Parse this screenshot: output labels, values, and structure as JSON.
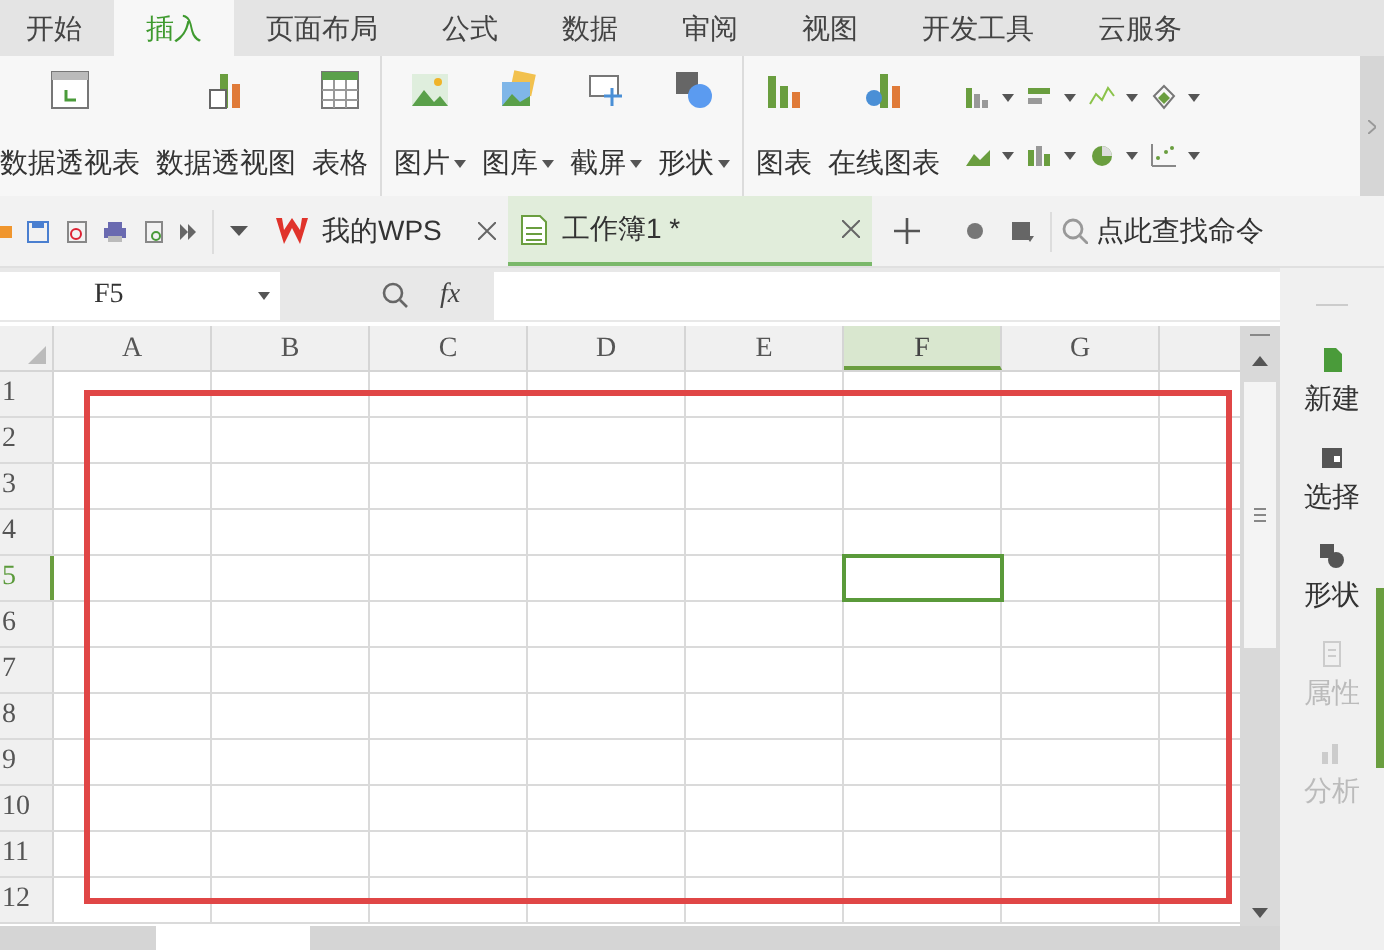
{
  "menu_tabs": [
    {
      "label": "开始",
      "selected": false
    },
    {
      "label": "插入",
      "selected": true
    },
    {
      "label": "页面布局",
      "selected": false
    },
    {
      "label": "公式",
      "selected": false
    },
    {
      "label": "数据",
      "selected": false
    },
    {
      "label": "审阅",
      "selected": false
    },
    {
      "label": "视图",
      "selected": false
    },
    {
      "label": "开发工具",
      "selected": false
    },
    {
      "label": "云服务",
      "selected": false
    }
  ],
  "ribbon": {
    "groups": [
      {
        "items": [
          {
            "label": "数据透视表",
            "dropdown": false
          },
          {
            "label": "数据透视图",
            "dropdown": false
          },
          {
            "label": "表格",
            "dropdown": false
          }
        ]
      },
      {
        "items": [
          {
            "label": "图片",
            "dropdown": true
          },
          {
            "label": "图库",
            "dropdown": true
          },
          {
            "label": "截屏",
            "dropdown": true
          },
          {
            "label": "形状",
            "dropdown": true
          }
        ]
      },
      {
        "items": [
          {
            "label": "图表",
            "dropdown": false
          },
          {
            "label": "在线图表",
            "dropdown": false
          }
        ]
      }
    ]
  },
  "doc_tabs": [
    {
      "label": "我的WPS",
      "selected": false
    },
    {
      "label": "工作簿1 *",
      "selected": true
    }
  ],
  "search": {
    "placeholder": "点此查找命令"
  },
  "name_box": {
    "value": "F5"
  },
  "formula_bar": {
    "function_label": "fx"
  },
  "grid": {
    "columns": [
      {
        "label": "A",
        "selected": false
      },
      {
        "label": "B",
        "selected": false
      },
      {
        "label": "C",
        "selected": false
      },
      {
        "label": "D",
        "selected": false
      },
      {
        "label": "E",
        "selected": false
      },
      {
        "label": "F",
        "selected": true
      },
      {
        "label": "G",
        "selected": false
      }
    ],
    "rows": [
      {
        "label": "1",
        "selected": false
      },
      {
        "label": "2",
        "selected": false
      },
      {
        "label": "3",
        "selected": false
      },
      {
        "label": "4",
        "selected": false
      },
      {
        "label": "5",
        "selected": true
      },
      {
        "label": "6",
        "selected": false
      },
      {
        "label": "7",
        "selected": false
      },
      {
        "label": "8",
        "selected": false
      },
      {
        "label": "9",
        "selected": false
      },
      {
        "label": "10",
        "selected": false
      },
      {
        "label": "11",
        "selected": false
      },
      {
        "label": "12",
        "selected": false
      }
    ]
  },
  "side_panel": {
    "items": [
      {
        "label": "新建",
        "disabled": false
      },
      {
        "label": "选择",
        "disabled": false
      },
      {
        "label": "形状",
        "disabled": false
      },
      {
        "label": "属性",
        "disabled": true
      },
      {
        "label": "分析",
        "disabled": true
      }
    ]
  }
}
